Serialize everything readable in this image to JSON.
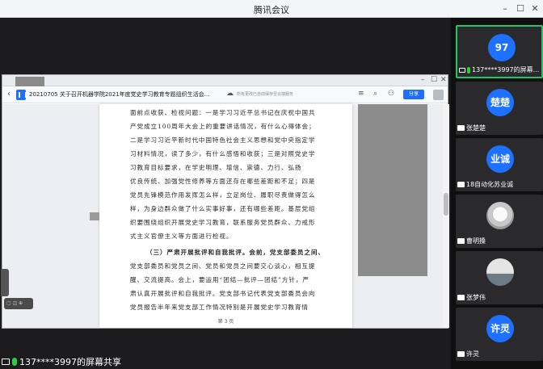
{
  "window": {
    "title": "腾讯会议"
  },
  "shared": {
    "doc_title": "20210705 关于召开机器学院2021年度党史学习教育专题组织生活会...",
    "cloud_note": "所有更改已自动保存至云端服务",
    "share_label": "分享",
    "lines": [
      "面前点收获、检视问题：一是学习习近平总书记在庆祝中国共",
      "产党成立100周年大会上的重要讲话情况，有什么心得体会；",
      "二是学习习近平新时代中国特色社会主义思想和党中央指定学",
      "习材料情况，读了多少，有什么感悟和收获；三是对照党史学",
      "习教育目标要求，在学史明理、增信、崇德、力行、弘扬",
      "优良传统、加强党性修养等方面还存在哪些差距和不足；四是",
      "党员先锋模范作用发挥怎么样，立足岗位、履职尽责做得怎么",
      "样，为身边群众做了什么实事好事，还有哪些差距。基层党组",
      "织要围绕组织开展党史学习教育，联系服务党员群众、力戒形",
      "式主义官僚主义等方面进行检视。",
      "（三）严肃开展批评和自我批评。会前，党支部委员之间、",
      "党支部委员和党员之间、党员和党员之间要交心谈心，相互提",
      "醒、交流提高。会上，要运用“团结—批评—团结”方针，严",
      "肃认真开展批评和自我批评。党支部书记代表党支部委员会向",
      "党员报告半年来党支部工作情况特别是开展党史学习教育情"
    ],
    "page_num": "第 3 页",
    "self_label": "137****3997的屏幕共享"
  },
  "gallery": [
    {
      "avatar": "97",
      "label": "137****3997的屏幕...",
      "active": true,
      "icon": "screen-share-icon"
    },
    {
      "avatar": "楚楚",
      "label": "张楚楚",
      "active": false,
      "icon": "camera-icon"
    },
    {
      "avatar": "业诚",
      "label": "18自动化苏业诚",
      "active": false,
      "icon": "camera-icon"
    },
    {
      "avatar": "",
      "label": "曹明搡",
      "active": false,
      "icon": "camera-icon"
    },
    {
      "avatar": "",
      "label": "张梦伟",
      "active": false,
      "icon": "camera-icon"
    },
    {
      "avatar": "许灵",
      "label": "许灵",
      "active": false,
      "icon": "camera-icon"
    }
  ],
  "colors": {
    "accent": "#1e70ff",
    "active_border": "#27c26b",
    "mic": "#2ecc40"
  }
}
